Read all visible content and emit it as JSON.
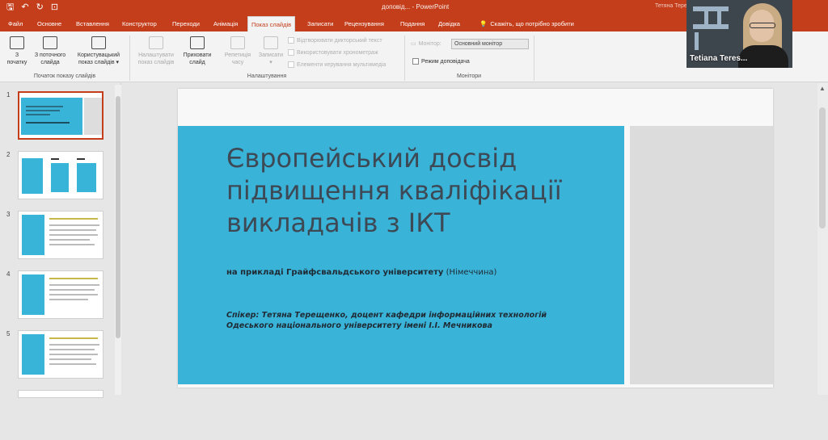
{
  "titlebar": {
    "quick_access": {
      "save": "🖫",
      "undo": "↶",
      "redo": "↻",
      "present": "⊡"
    },
    "doc_title": "доповід... - PowerPoint",
    "user": "Тетяна Тере..."
  },
  "tabs": [
    {
      "label": "Файл"
    },
    {
      "label": "Основне"
    },
    {
      "label": "Вставлення"
    },
    {
      "label": "Конструктор"
    },
    {
      "label": "Переходи"
    },
    {
      "label": "Анімація"
    },
    {
      "label": "Показ слайдів",
      "active": true
    },
    {
      "label": "Записати"
    },
    {
      "label": "Рецензування"
    },
    {
      "label": "Подання"
    },
    {
      "label": "Довідка"
    }
  ],
  "tell_me": {
    "icon": "lightbulb-icon",
    "text": "Скажіть, що потрібно зробити"
  },
  "ribbon": {
    "start": {
      "from_beginning": "З\nпочатку",
      "from_current": "З поточного\nслайда",
      "custom_show": "Користувацький\nпоказ слайдів ▾",
      "group": "Початок показу слайдів"
    },
    "setup": {
      "setup_show": "Налаштувати\nпоказ слайдів",
      "hide_slide": "Приховати\nслайд",
      "rehearse": "Репетиція\nчасу",
      "record": "Записати\n▾",
      "chk_narrations": "Відтворювати дикторський текст",
      "chk_timings": "Використовувати хронометраж",
      "chk_media": "Елементи керування мультимедіа",
      "group": "Налаштування"
    },
    "monitors": {
      "monitor_label": "Монітор:",
      "monitor_value": "Основний монітор",
      "presenter_view": "Режим доповідача",
      "group": "Монітори"
    }
  },
  "thumbnails": [
    {
      "number": "1"
    },
    {
      "number": "2"
    },
    {
      "number": "3"
    },
    {
      "number": "4"
    },
    {
      "number": "5"
    }
  ],
  "slide": {
    "title": "Європейський досвід\nпідвищення кваліфікації\nвикладачів з ІКТ",
    "subtitle_bold": "на прикладі Грайфсвальдського університету",
    "subtitle_thin": " (Німеччина)",
    "speaker": "Спікер: Тетяна Терещенко, доцент кафедри інформаційних технологій\nОдеського національного університету імені І.І. Мечникова"
  },
  "video": {
    "name": "Tetiana Teres..."
  },
  "colors": {
    "accent": "#c43e1c",
    "slide_blue": "#3ab3d9"
  }
}
